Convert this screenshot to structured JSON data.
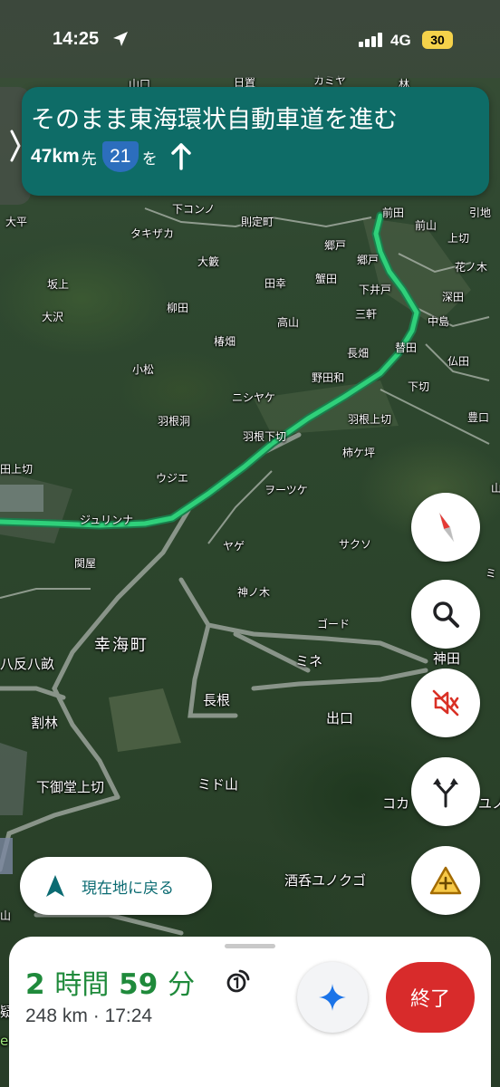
{
  "status_bar": {
    "time": "14:25",
    "network": "4G",
    "battery": "30"
  },
  "navigation": {
    "instruction": "そのまま東海環状自動車道を進む",
    "distance": "47km",
    "distance_suffix": "先",
    "route_number": "21",
    "particle": "を"
  },
  "map_labels": [
    "山口",
    "日置",
    "カミヤ",
    "林",
    "下コンノ",
    "則定町",
    "前田",
    "前山",
    "引地",
    "大平",
    "タキザカ",
    "郷戸",
    "上切",
    "大籔",
    "郷戸",
    "花ノ木",
    "坂上",
    "田幸",
    "蟹田",
    "下井戸",
    "深田",
    "柳田",
    "三軒",
    "中島",
    "大沢",
    "高山",
    "替田",
    "椿畑",
    "長畑",
    "仏田",
    "小松",
    "野田和",
    "下切",
    "ニシヤケ",
    "羽根洞",
    "羽根上切",
    "豊口",
    "羽根下切",
    "柿ケ坪",
    "田上切",
    "ウジエ",
    "ヲーツケ",
    "山",
    "ジュリンナ",
    "ヤゲ",
    "サクソ",
    "関屋",
    "ミ",
    "神ノ木",
    "ゴード",
    "幸海町",
    "神田",
    "ミネ",
    "八反八畝",
    "長根",
    "割林",
    "出口",
    "下御堂上切",
    "ミド山",
    "コカ",
    "ユノ",
    "酒呑ユノクゴ",
    "山",
    "疑",
    "e"
  ],
  "buttons": {
    "recenter_label": "現在地に戻る",
    "end_label": "終了"
  },
  "eta": {
    "hours": "2",
    "hours_unit": "時間",
    "minutes": "59",
    "minutes_unit": "分",
    "distance": "248 km",
    "separator": "·",
    "arrival": "17:24"
  },
  "colors": {
    "banner": "#0e6c67",
    "route": "#2fd07a",
    "duration": "#1f8a3b",
    "end_button": "#d82b2b",
    "mute_icon": "#d93025",
    "gemini": "#1a73e8"
  },
  "icons": {
    "compass": "compass-icon",
    "search": "search-icon",
    "mute": "volume-off-icon",
    "route_options": "fork-arrows-icon",
    "report": "warning-plus-icon",
    "recenter": "navigation-arrow-icon",
    "gemini": "sparkle-icon",
    "alternate": "alt-route-icon"
  }
}
